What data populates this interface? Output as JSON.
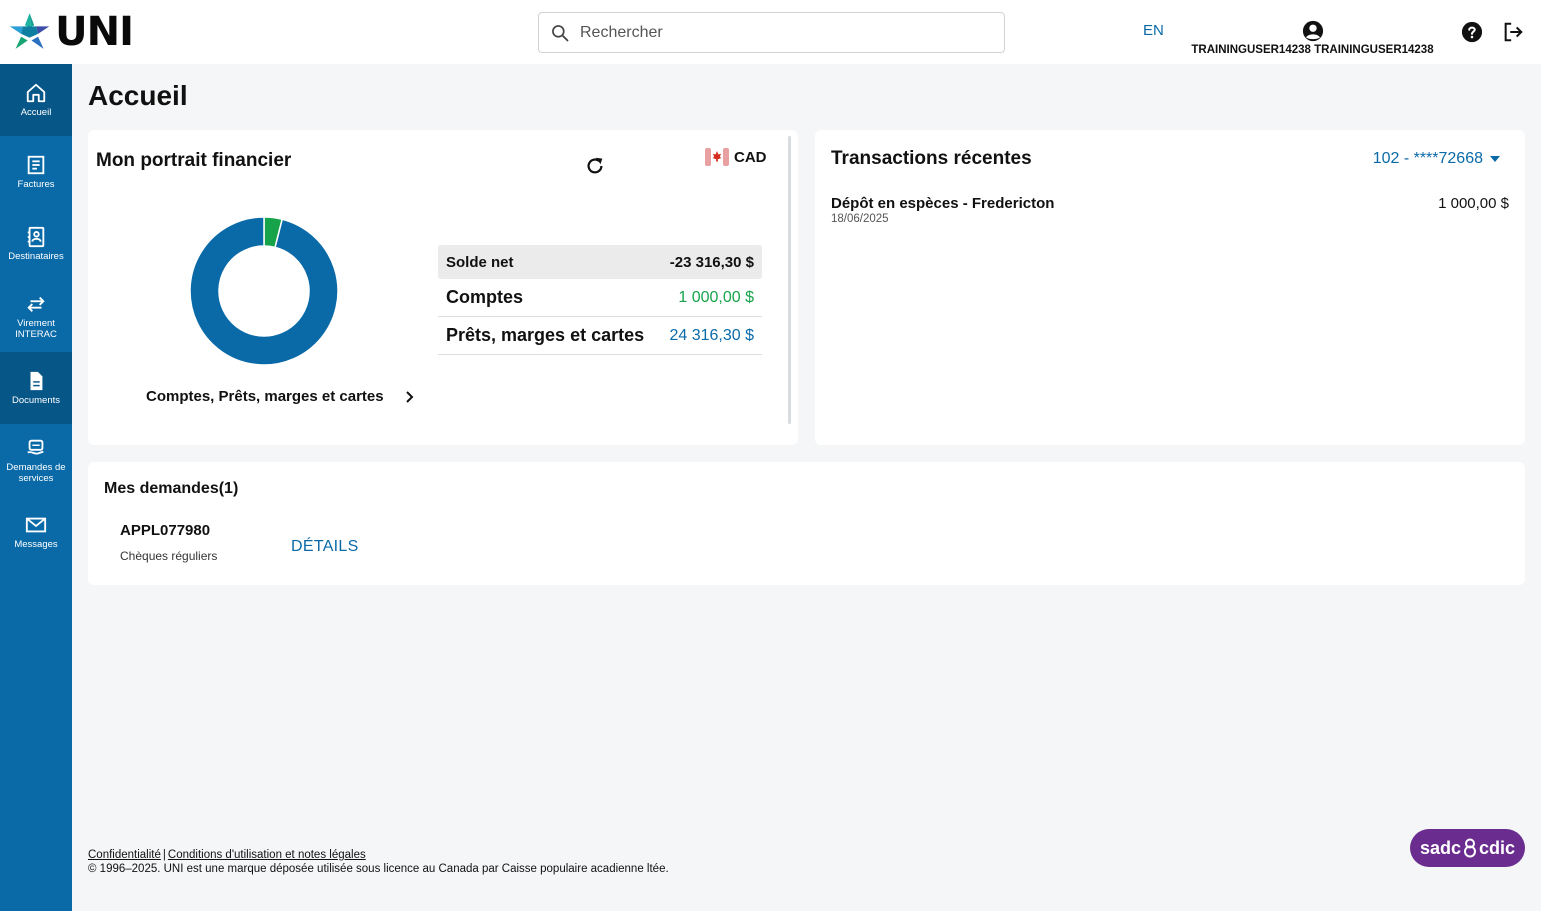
{
  "header": {
    "logo_text": "UNI",
    "search_placeholder": "Rechercher",
    "language": "EN",
    "user_name": "TRAININGUSER14238 TRAININGUSER14238"
  },
  "sidebar": {
    "items": [
      {
        "label": "Accueil",
        "icon": "home-icon"
      },
      {
        "label": "Factures",
        "icon": "invoice-icon"
      },
      {
        "label": "Destinataires",
        "icon": "contacts-icon"
      },
      {
        "label": "Virement INTERAC",
        "icon": "transfer-icon"
      },
      {
        "label": "Documents",
        "icon": "document-icon"
      },
      {
        "label": "Demandes de services",
        "icon": "service-icon"
      },
      {
        "label": "Messages",
        "icon": "mail-icon"
      }
    ]
  },
  "page": {
    "title": "Accueil"
  },
  "portrait": {
    "title": "Mon portrait financier",
    "currency": "CAD",
    "link_label": "Comptes, Prêts, marges et cartes",
    "net_label": "Solde net",
    "net_value": "-23 316,30 $",
    "accounts_label": "Comptes",
    "accounts_value": "1 000,00 $",
    "loans_label": "Prêts, marges et cartes",
    "loans_value": "24 316,30 $"
  },
  "chart_data": {
    "type": "pie",
    "categories": [
      "Comptes",
      "Prêts, marges et cartes"
    ],
    "values": [
      1000.0,
      24316.3
    ],
    "colors": [
      "#16a34a",
      "#0a6aa8"
    ],
    "donut": true
  },
  "transactions": {
    "title": "Transactions récentes",
    "account": "102 - ****72668",
    "items": [
      {
        "description": "Dépôt en espèces - Fredericton",
        "date": "18/06/2025",
        "amount": "1 000,00 $"
      }
    ]
  },
  "demandes": {
    "title": "Mes demandes(1)",
    "items": [
      {
        "id": "APPL077980",
        "type": "Chèques réguliers",
        "action": "DÉTAILS"
      }
    ]
  },
  "footer": {
    "privacy": "Confidentialité",
    "separator": "|",
    "terms": "Conditions d'utilisation et notes légales",
    "copyright": "© 1996–2025. UNI est une marque déposée utilisée sous licence au Canada par Caisse populaire acadienne ltée.",
    "badge_left": "sadc",
    "badge_right": "cdic"
  },
  "colors": {
    "brand_blue": "#0a6aa8",
    "sidebar_active": "#075688",
    "positive_green": "#16a34a",
    "cdic_purple": "#6b2c8f"
  }
}
